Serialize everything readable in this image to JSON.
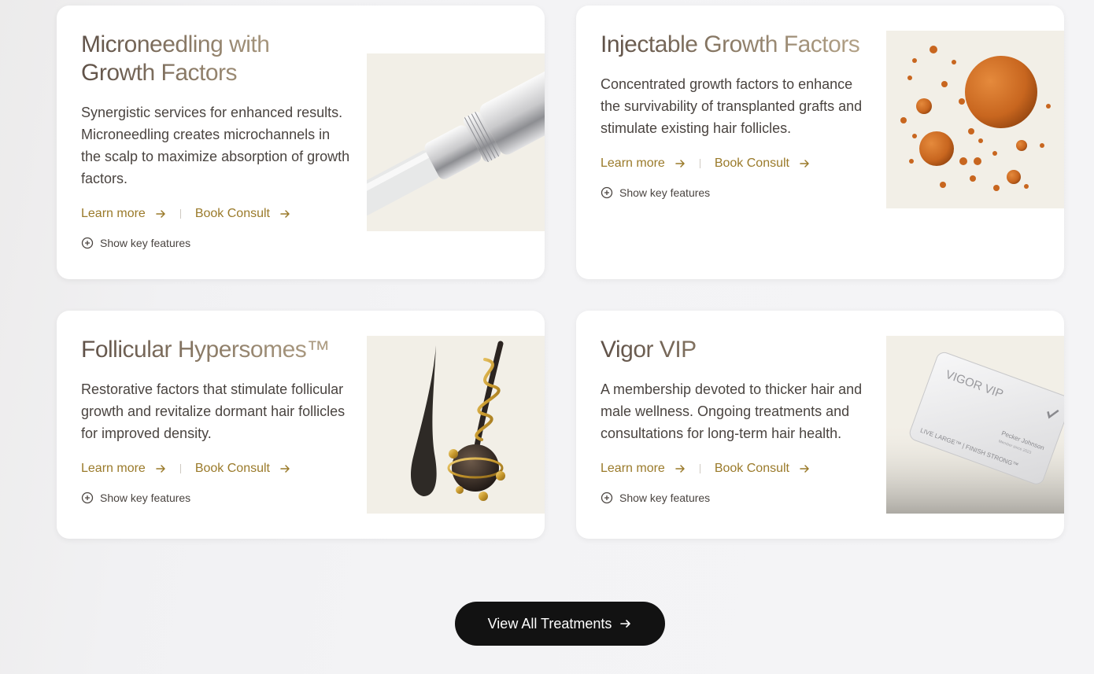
{
  "cards": [
    {
      "title": "Microneedling with Growth Factors",
      "description": "Synergistic services for enhanced results. Microneedling creates microchannels in the scalp to maximize absorption of growth factors.",
      "learn_more": "Learn more",
      "book_consult": "Book Consult",
      "show_features": "Show key features",
      "image": "microneedling-pen"
    },
    {
      "title": "Injectable Growth Factors",
      "description": "Concentrated growth factors to enhance the survivability of transplanted grafts and stimulate existing hair follicles.",
      "learn_more": "Learn more",
      "book_consult": "Book Consult",
      "show_features": "Show key features",
      "image": "orange-growth-spheres"
    },
    {
      "title": "Follicular Hypersomes™",
      "description": "Restorative factors that stimulate follicular growth and revitalize dormant hair follicles for improved density.",
      "learn_more": "Learn more",
      "book_consult": "Book Consult",
      "show_features": "Show key features",
      "image": "hair-follicles"
    },
    {
      "title": "Vigor VIP",
      "description": "A membership devoted to thicker hair and male wellness. Ongoing treatments and consultations for long-term hair health.",
      "learn_more": "Learn more",
      "book_consult": "Book Consult",
      "show_features": "Show key features",
      "image": "vip-membership-card",
      "card_text": {
        "brand": "VIGOR VIP",
        "holder": "Pecker Johnson",
        "since": "Member since 2023",
        "slogan": "LIVE LARGE™ | FINISH STRONG™"
      }
    }
  ],
  "cta": {
    "label": "View All Treatments"
  },
  "colors": {
    "accent": "#9a7a2a",
    "text": "#4a4440",
    "cta_bg": "#121212",
    "media_bg": "#f2efe7"
  }
}
